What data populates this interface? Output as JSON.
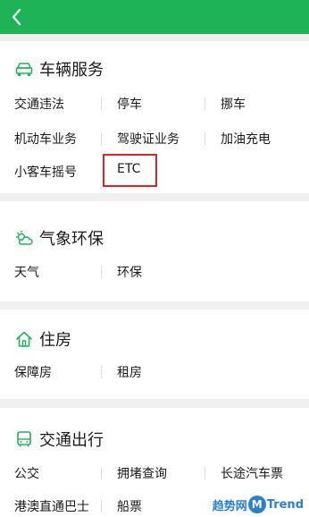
{
  "sections": [
    {
      "title": "车辆服务",
      "icon": "car-icon",
      "rows": [
        [
          "交通违法",
          "停车",
          "挪车"
        ],
        [
          "机动车业务",
          "驾驶证业务",
          "加油充电"
        ],
        [
          "小客车摇号",
          "ETC"
        ]
      ]
    },
    {
      "title": "气象环保",
      "icon": "weather-icon",
      "rows": [
        [
          "天气",
          "环保"
        ]
      ]
    },
    {
      "title": "住房",
      "icon": "house-icon",
      "rows": [
        [
          "保障房",
          "租房"
        ]
      ]
    },
    {
      "title": "交通出行",
      "icon": "bus-icon",
      "rows": [
        [
          "公交",
          "拥堵查询",
          "长途汽车票"
        ],
        [
          "港澳直通巴士",
          "船票"
        ]
      ]
    }
  ],
  "watermark": {
    "left": "趋势网",
    "m": "M",
    "right": "Trend"
  },
  "colors": {
    "header": "#1fb357",
    "icon": "#1fb357",
    "highlight": "#d6262b"
  }
}
